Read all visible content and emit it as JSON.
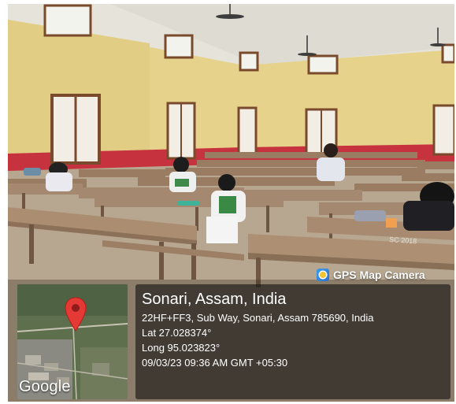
{
  "gps_badge": {
    "label": "GPS Map Camera",
    "icon": "camera-app-icon"
  },
  "location": {
    "title": "Sonari, Assam, India",
    "address": "22HF+FF3, Sub Way, Sonari, Assam 785690, India",
    "latitude": "Lat 27.028374°",
    "longitude": "Long 95.023823°",
    "datetime": "09/03/23 09:36 AM GMT +05:30"
  },
  "map": {
    "provider_logo": "Google",
    "marker_icon": "map-pin-icon",
    "marker_color": "#e53935"
  },
  "photo": {
    "desk_chalk_mark": "SC 2018"
  },
  "colors": {
    "wall_upper": "#e8d48a",
    "wall_lower": "#c8323c",
    "ceiling": "#e9e7df",
    "floor": "#b8a894",
    "desk": "#a98b6e"
  }
}
